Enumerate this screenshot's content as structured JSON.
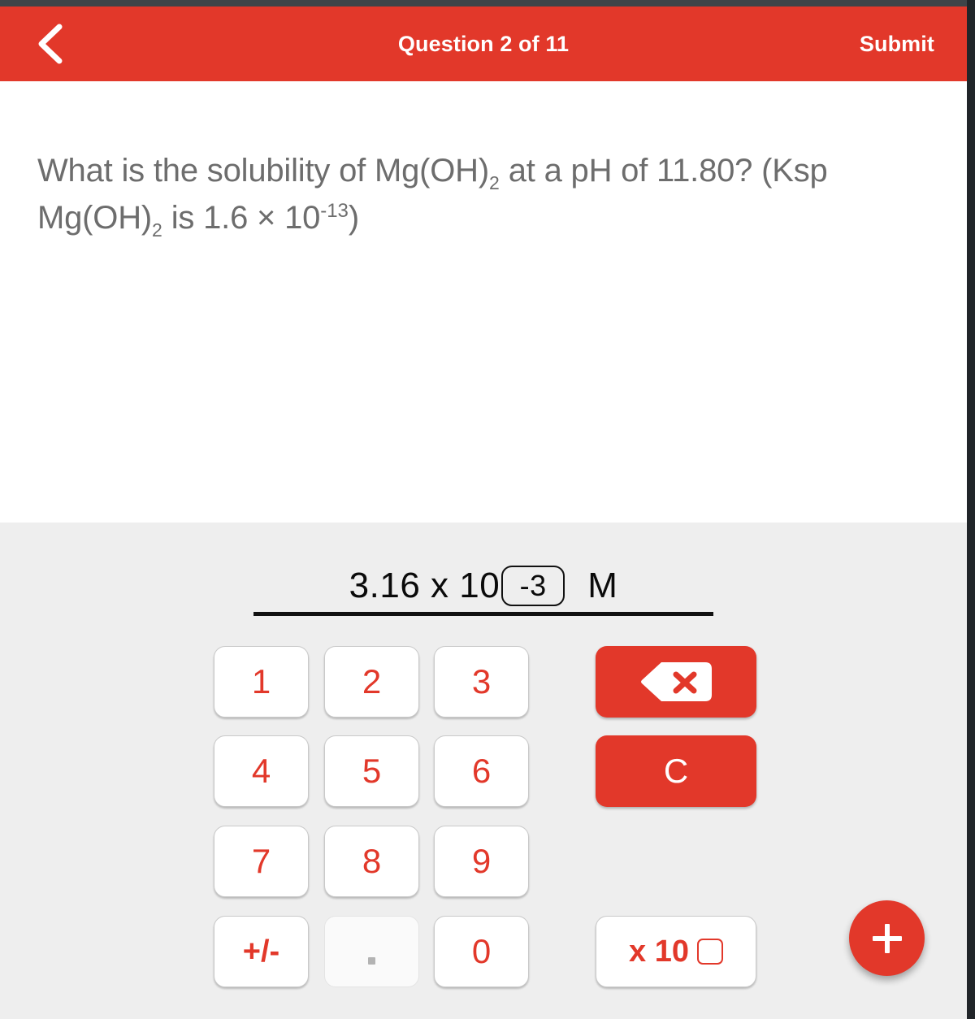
{
  "colors": {
    "brand_red": "#e2382a",
    "panel_gray": "#eeeeee",
    "question_text": "#6d6d6d",
    "key_border": "#c9c9c9",
    "edge_dark": "#212529"
  },
  "header": {
    "back_label": "Back",
    "title": "Question 2 of 11",
    "submit_label": "Submit"
  },
  "question": {
    "part1": "What is the solubility of Mg(OH)",
    "sub1": "2",
    "part2": " at a pH of 11.80? (Ksp Mg(OH)",
    "sub2": "2",
    "part3": " is 1.6 × 10",
    "sup1": "-13",
    "part4": ")",
    "full_text": "What is the solubility of Mg(OH)2 at a pH of 11.80? (Ksp Mg(OH)2 is 1.6 × 10-13)"
  },
  "answer": {
    "mantissa": "3.16 x 10",
    "exponent": "-3",
    "unit": "M",
    "full_value": "3.16 x 10^-3 M"
  },
  "keypad": {
    "rows": [
      [
        "1",
        "2",
        "3"
      ],
      [
        "4",
        "5",
        "6"
      ],
      [
        "7",
        "8",
        "9"
      ],
      [
        "+/-",
        ".",
        "0"
      ]
    ],
    "key_1": "1",
    "key_2": "2",
    "key_3": "3",
    "key_4": "4",
    "key_5": "5",
    "key_6": "6",
    "key_7": "7",
    "key_8": "8",
    "key_9": "9",
    "key_0": "0",
    "key_sign": "+/-",
    "key_decimal": ".",
    "key_backspace": "backspace-icon",
    "key_clear": "C",
    "key_exponent": "x 10",
    "key_exponent_placeholder": ""
  },
  "fab": {
    "label": "+"
  }
}
